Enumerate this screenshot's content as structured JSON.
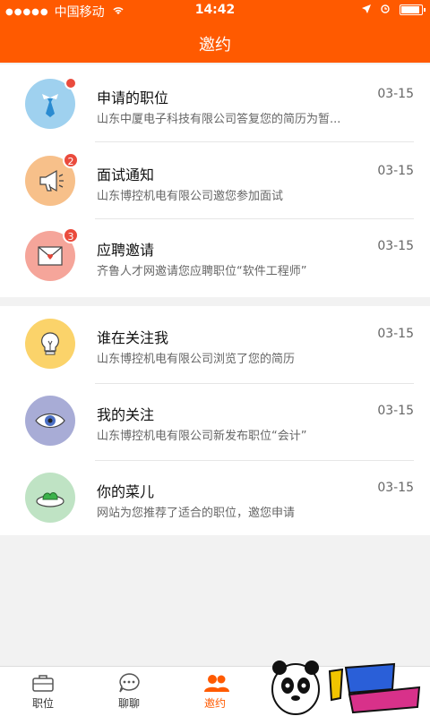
{
  "status_bar": {
    "signal": "●●●●●",
    "carrier": "中国移动",
    "wifi": "wifi",
    "time": "14:42"
  },
  "header": {
    "title": "邀约"
  },
  "items_group1": [
    {
      "title": "申请的职位",
      "subtitle": "山东中厦电子科技有限公司答复您的简历为暂...",
      "date": "03-15",
      "badge": "",
      "icon": "tie-icon"
    },
    {
      "title": "面试通知",
      "subtitle": "山东博控机电有限公司邀您参加面试",
      "date": "03-15",
      "badge": "2",
      "icon": "megaphone-icon"
    },
    {
      "title": "应聘邀请",
      "subtitle": "齐鲁人才网邀请您应聘职位“软件工程师”",
      "date": "03-15",
      "badge": "3",
      "icon": "envelope-icon"
    }
  ],
  "items_group2": [
    {
      "title": "谁在关注我",
      "subtitle": "山东博控机电有限公司浏览了您的简历",
      "date": "03-15",
      "icon": "lightbulb-icon"
    },
    {
      "title": "我的关注",
      "subtitle": "山东博控机电有限公司新发布职位“会计”",
      "date": "03-15",
      "icon": "eye-icon"
    },
    {
      "title": "你的菜儿",
      "subtitle": "网站为您推荐了适合的职位，邀您申请",
      "date": "03-15",
      "icon": "dish-icon"
    }
  ],
  "tabbar": [
    {
      "label": "职位",
      "icon": "briefcase-icon"
    },
    {
      "label": "聊聊",
      "icon": "chat-icon"
    },
    {
      "label": "邀约",
      "icon": "people-icon",
      "active": true
    }
  ],
  "colors": {
    "accent": "#ff5a00",
    "tie_bg": "#9fd1ef",
    "megaphone_bg": "#f7c08a",
    "envelope_bg": "#f5a59a",
    "bulb_bg": "#fbd36a",
    "eye_bg": "#a8acd6",
    "dish_bg": "#bfe3c4"
  }
}
